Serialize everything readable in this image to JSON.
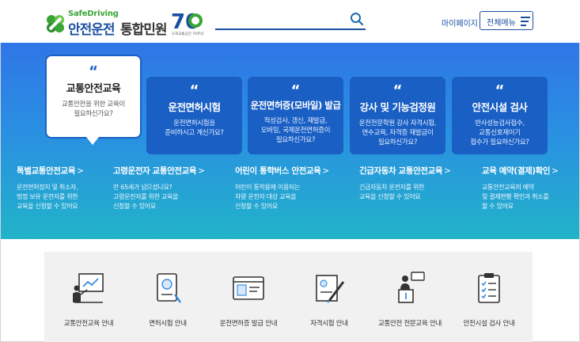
{
  "header": {
    "logo_sub": "SafeDriving",
    "logo_main": "안전운전",
    "logo_main2": "통합민원",
    "anniv_number": "70",
    "anniv_caption": "도로교통공단 70주년",
    "search_placeholder": "",
    "mypage_label": "마이페이지",
    "allmenu_label": "전체메뉴"
  },
  "colors": {
    "brand_blue": "#1a4fa0",
    "brand_green": "#3aa535",
    "card_blue": "#1a5fc4"
  },
  "cards": [
    {
      "title": "교통안전교육",
      "desc": "교통안전을 위한 교육이\n필요하신가요?"
    },
    {
      "title": "운전면허시험",
      "desc": "운전면허시험을\n준비하시고 계신가요?"
    },
    {
      "title": "운전면허증(모바일) 발급",
      "desc": "적성검사, 갱신, 재발급,\n모바일, 국제운전면허증이\n필요하신가요?"
    },
    {
      "title": "강사 및 기능검정원",
      "desc": "운전전문학원 강사 자격시험,\n연수교육, 자격증 재발급이\n필요하신가요?"
    },
    {
      "title": "안전시설 검사",
      "desc": "반사성능검사접수,\n교통신호제어기\n접수가 필요하신가요?"
    }
  ],
  "links": [
    {
      "title": "특별교통안전교육",
      "desc": "운전면허정지 및 취소자,\n법정 보유 운전자를 위한\n교육을 신청할 수 있어요"
    },
    {
      "title": "고령운전자 교통안전교육",
      "desc": "만 65세가 넘으셨나요?\n고령운전자를 위한 교육을\n신청할 수 있어요"
    },
    {
      "title": "어린이 통학버스 안전교육",
      "desc": "어린이 통학용에 이용되는\n차량 운전자 대상 교육을\n신청할 수 있어요"
    },
    {
      "title": "긴급자동차 교통안전교육",
      "desc": "긴급자동차 운전자를 위한\n교육을 신청할 수 있어요"
    },
    {
      "title": "교육 예약(결제)확인",
      "desc": "교통안전교육의 예약\n및 결제현황 확인과 취소를\n할 수 있어요"
    }
  ],
  "link_chevron": ">",
  "quote_mark": "“",
  "services": [
    {
      "label": "교통안전교육 안내",
      "icon": "lecture-board-icon"
    },
    {
      "label": "면허시험 안내",
      "icon": "license-book-icon"
    },
    {
      "label": "운전면허증 발급 안내",
      "icon": "id-card-icon"
    },
    {
      "label": "자격시험 안내",
      "icon": "certificate-pen-icon"
    },
    {
      "label": "교통안전 전문교육 안내",
      "icon": "speaker-podium-icon"
    },
    {
      "label": "안전시설 검사 안내",
      "icon": "checklist-icon"
    }
  ]
}
